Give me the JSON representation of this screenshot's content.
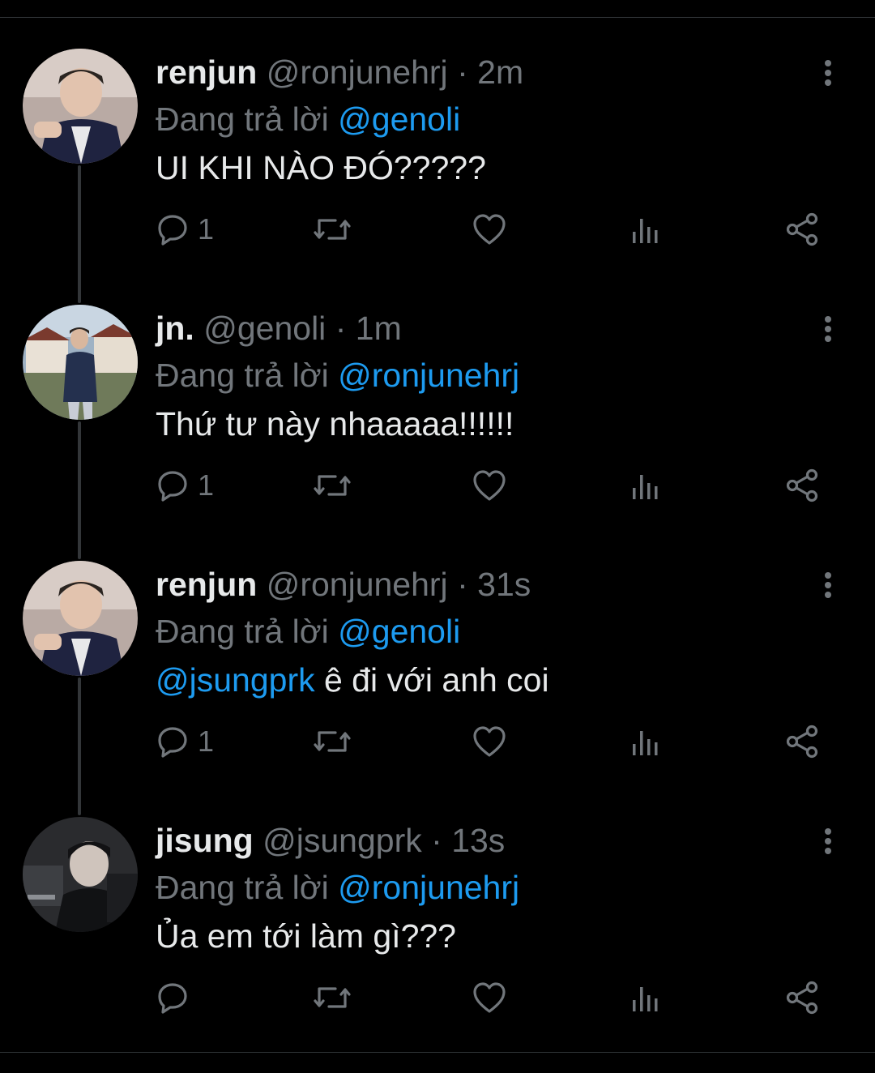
{
  "tweets": [
    {
      "name": "renjun",
      "handle": "@ronjunehrj",
      "dot": "·",
      "time": "2m",
      "reply_prefix": "Đang trả lời",
      "reply_to": "@genoli",
      "text_mention": "",
      "text": "UI KHI NÀO ĐÓ?????",
      "reply_count": "1",
      "avatar": "avatar-photo-renjun"
    },
    {
      "name": "jn.",
      "handle": "@genoli",
      "dot": "·",
      "time": "1m",
      "reply_prefix": "Đang trả lời",
      "reply_to": "@ronjunehrj",
      "text_mention": "",
      "text": "Thứ tư này nhaaaaa!!!!!!",
      "reply_count": "1",
      "avatar": "avatar-photo-jn"
    },
    {
      "name": "renjun",
      "handle": "@ronjunehrj",
      "dot": "·",
      "time": "31s",
      "reply_prefix": "Đang trả lời",
      "reply_to": "@genoli",
      "text_mention": "@jsungprk",
      "text": " ê đi với anh coi",
      "reply_count": "1",
      "avatar": "avatar-photo-renjun"
    },
    {
      "name": "jisung",
      "handle": "@jsungprk",
      "dot": "·",
      "time": "13s",
      "reply_prefix": "Đang trả lời",
      "reply_to": "@ronjunehrj",
      "text_mention": "",
      "text": "Ủa em tới làm gì???",
      "reply_count": "",
      "avatar": "avatar-photo-jisung"
    }
  ],
  "icons": {
    "reply": "reply-icon",
    "retweet": "retweet-icon",
    "like": "like-icon",
    "views": "views-icon",
    "share": "share-icon",
    "more": "more-icon"
  },
  "colors": {
    "background": "#000000",
    "text": "#e7e9ea",
    "secondary": "#71767b",
    "accent": "#1d9bf0",
    "thread_line": "#333639"
  }
}
